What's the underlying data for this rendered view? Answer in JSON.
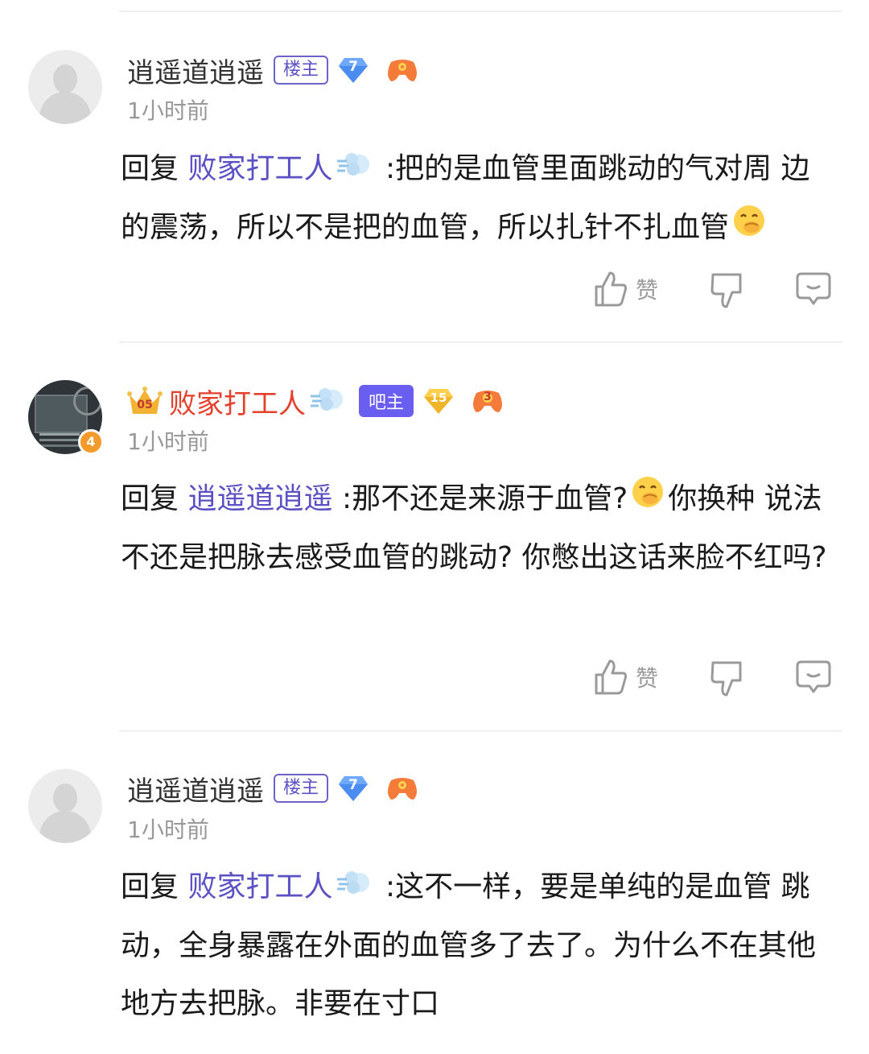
{
  "colors": {
    "link": "#5b51c4",
    "host_tag": "#6c63c9",
    "owner_tag": "#6a5ef0",
    "red_name": "#e5402c",
    "time": "#999999"
  },
  "comments": [
    {
      "username": "逍遥道逍遥",
      "tag": "楼主",
      "gem_level": "7",
      "time": "1小时前",
      "reply_prefix": "回复",
      "reply_to": "败家打工人",
      "text_line1": ":把的是血管里面跳动的气对周",
      "text_rest": "边的震荡，所以不是把的血管，所以扎针不扎血管",
      "like_label": "赞",
      "icons": [
        "blank-avatar",
        "diamond-level-icon",
        "game-controller-icon",
        "dash-emoji",
        "giggle-emoji"
      ]
    },
    {
      "username": "败家打工人",
      "tag": "吧主",
      "gem_level": "15",
      "game_level": "3",
      "avatar_level": "4",
      "crown_text": "05",
      "time": "1小时前",
      "reply_prefix": "回复",
      "reply_to": "逍遥道逍遥",
      "text_line1a": ":那不还是来源于血管?",
      "text_line1b": "你换种",
      "text_rest": "说法不还是把脉去感受血管的跳动? 你憋出这话来脸不红吗?",
      "like_label": "赞",
      "icons": [
        "crown-icon",
        "dash-emoji",
        "diamond-level-icon",
        "game-controller-icon",
        "giggle-emoji"
      ]
    },
    {
      "username": "逍遥道逍遥",
      "tag": "楼主",
      "gem_level": "7",
      "time": "1小时前",
      "reply_prefix": "回复",
      "reply_to": "败家打工人",
      "text_line1": ":这不一样，要是单纯的是血管",
      "text_rest": "跳动，全身暴露在外面的血管多了去了。为什么不在其他地方去把脉。非要在寸口",
      "like_label": "赞"
    }
  ]
}
